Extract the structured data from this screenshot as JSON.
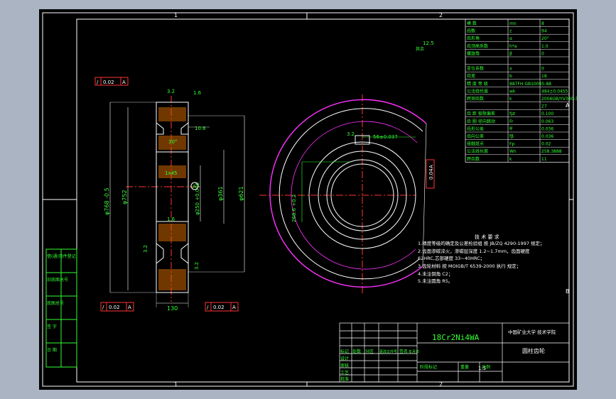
{
  "drawing": {
    "zone_labels": {
      "top_1": "1",
      "top_2": "2",
      "bottom_1": "1",
      "bottom_2": "2",
      "right_a": "A",
      "right_b": "B"
    },
    "material": "18Cr2Ni4WA",
    "school": "中国矿业大学 技术学院",
    "part_name": "圆柱齿轮",
    "scale": "1:5",
    "surface_roughness_general": "12.5",
    "surface_roughness_label": "其余"
  },
  "section_view": {
    "dims": {
      "outer_dia": "φ768 -0.5",
      "tip_dia": "φ752",
      "bore_dia": "φ250 +0.046",
      "hub_dia": "φ361",
      "web_dia": "φ621",
      "width": "130",
      "web_thk": "10.6",
      "chamfer": "1x45",
      "angle": "30°",
      "rough_1": "3.2",
      "rough_2": "1.6",
      "rough_3": "1.6",
      "rough_4": "3.2",
      "rough_5": "3.2",
      "datum_a": "A"
    },
    "tolerance_frames": [
      {
        "symbol": "/",
        "value": "0.02",
        "datum": "A"
      },
      {
        "symbol": "/",
        "value": "0.02",
        "datum": "A"
      },
      {
        "symbol": "/",
        "value": "0.02",
        "datum": "A"
      }
    ]
  },
  "front_view": {
    "keyway_width": "56±0.037",
    "keyway_depth": "268.6 +0.2",
    "rough": "3.2",
    "tol_frame": {
      "value": "0.04",
      "datum": "A"
    }
  },
  "notes": {
    "title": "技 术 要 求",
    "lines": [
      "1.精度等级的确定及公差检验组 按 JB/ZQ 4290-1997 规定；",
      "2.齿面渗碳淬火，渗碳层深度 1.2~1.7mm，齿面硬度",
      "  62HRC,芯部硬度 33~40HRC；",
      "3.齿轮材料 按 MOIGB/T 6539-2000 执行 规定；",
      "4.未注倒角 C2；",
      "5.未注圆角 R5。"
    ]
  },
  "param_table": [
    [
      "模 数",
      "mn",
      "8"
    ],
    [
      "齿数",
      "z",
      "94"
    ],
    [
      "齿形角",
      "α",
      "20°"
    ],
    [
      "齿顶高系数",
      "h*a",
      "1.0"
    ],
    [
      "螺旋角",
      "β",
      "0"
    ],
    [
      "",
      "",
      ""
    ],
    [
      "变位系数",
      "x",
      "0"
    ],
    [
      "齿宽",
      "b",
      "18"
    ],
    [
      "精 度 等 级",
      "887FH GB10095-88",
      ""
    ],
    [
      "公法线长度",
      "wk",
      "484±0.0455"
    ],
    [
      "跨测齿数",
      "k",
      "2006GB/YV300-3"
    ],
    [
      "",
      "",
      "27"
    ],
    [
      "齿 距 极限偏差",
      "fpt",
      "0.100"
    ],
    [
      "齿 圈 径向跳动",
      "Fr",
      "0.063"
    ],
    [
      "齿形公差",
      "ff",
      "0.036"
    ],
    [
      "齿向公差",
      "fβ",
      "0.036"
    ],
    [
      "接触斑点",
      "Fp",
      "0.02"
    ],
    [
      "公法线长度",
      "Wn",
      "258.3888"
    ],
    [
      "跨齿数",
      "k",
      "11"
    ]
  ],
  "left_strip": [
    "借(通)用件登记",
    "旧底图总号",
    "底图总号",
    "签 字",
    "日 期"
  ],
  "title_block": {
    "row_labels": [
      "标记",
      "处数",
      "分区",
      "更改文件号",
      "签名",
      "年月日"
    ],
    "design": "设计",
    "check": "审核",
    "process": "工艺",
    "approve": "批准",
    "stage": "阶段标记",
    "weight": "重量",
    "scale_label": "比例"
  },
  "colors": {
    "green": "#33ff33",
    "cyan": "#00ffff",
    "magenta": "#ff33ff",
    "white": "#ffffff",
    "red": "#ff3333",
    "yellow": "#ffff33"
  }
}
